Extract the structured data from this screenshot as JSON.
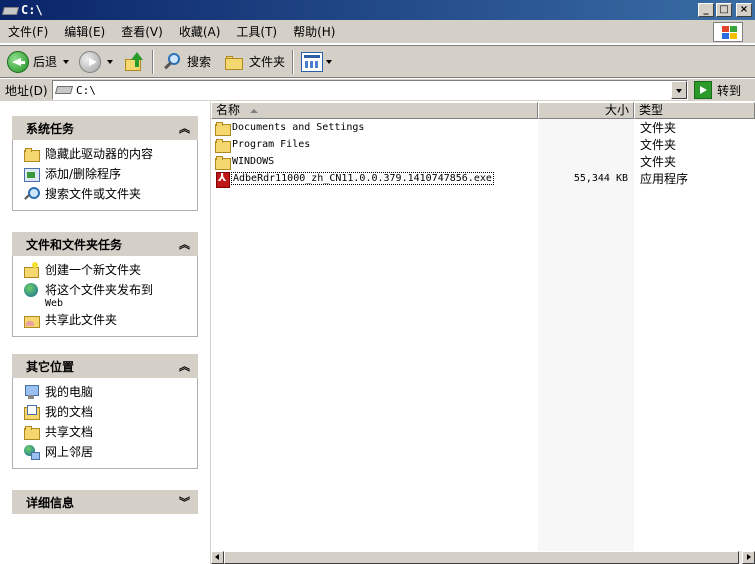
{
  "window": {
    "title": "C:\\",
    "buttons": {
      "minimize": "_",
      "maximize": "□",
      "close": "×"
    }
  },
  "menubar": {
    "items": [
      "文件(F)",
      "编辑(E)",
      "查看(V)",
      "收藏(A)",
      "工具(T)",
      "帮助(H)"
    ]
  },
  "toolbar": {
    "back_label": "后退",
    "search_label": "搜索",
    "folders_label": "文件夹"
  },
  "address": {
    "label": "地址(D)",
    "value": "C:\\",
    "go_label": "转到"
  },
  "tasks": {
    "system": {
      "title": "系统任务",
      "items": [
        {
          "label": "隐藏此驱动器的内容",
          "icon": "folder-icon"
        },
        {
          "label": "添加/删除程序",
          "icon": "program-icon"
        },
        {
          "label": "搜索文件或文件夹",
          "icon": "search-icon"
        }
      ]
    },
    "file_folder": {
      "title": "文件和文件夹任务",
      "items": [
        {
          "label": "创建一个新文件夹",
          "icon": "new-folder-icon"
        },
        {
          "label": "将这个文件夹发布到",
          "sub": "Web",
          "icon": "globe-icon"
        },
        {
          "label": "共享此文件夹",
          "icon": "share-icon"
        }
      ]
    },
    "other": {
      "title": "其它位置",
      "items": [
        {
          "label": "我的电脑",
          "icon": "computer-icon"
        },
        {
          "label": "我的文档",
          "icon": "documents-icon"
        },
        {
          "label": "共享文档",
          "icon": "shared-docs-icon"
        },
        {
          "label": "网上邻居",
          "icon": "network-icon"
        }
      ]
    },
    "details": {
      "title": "详细信息"
    }
  },
  "filelist": {
    "columns": {
      "name": "名称",
      "size": "大小",
      "type": "类型"
    },
    "rows": [
      {
        "name": "Documents and Settings",
        "size": "",
        "type": "文件夹",
        "icon": "folder-icon"
      },
      {
        "name": "Program Files",
        "size": "",
        "type": "文件夹",
        "icon": "folder-icon"
      },
      {
        "name": "WINDOWS",
        "size": "",
        "type": "文件夹",
        "icon": "folder-icon"
      },
      {
        "name": "AdbeRdr11000_zh_CN11.0.0.379.1410747856.exe",
        "size": "55,344 KB",
        "type": "应用程序",
        "icon": "pdf-exe-icon"
      }
    ]
  },
  "colors": {
    "title_bar_start": "#0a246a",
    "title_bar_end": "#3a6ea5",
    "chrome": "#d4d0c8",
    "go_green": "#2a9a2a"
  }
}
